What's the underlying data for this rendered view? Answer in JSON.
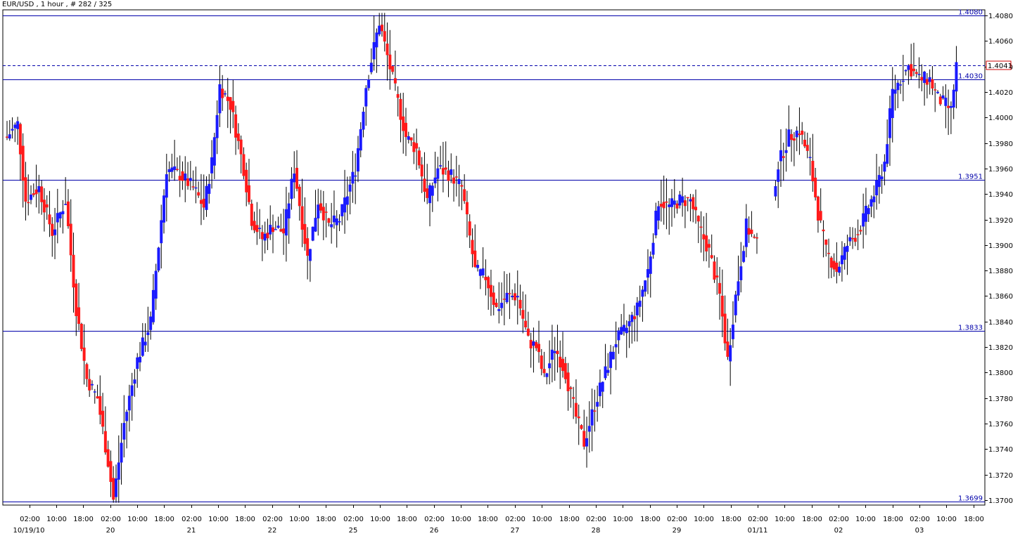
{
  "title": "EUR/USD , 1 hour , # 282 / 325",
  "chart_data": {
    "type": "candlestick",
    "symbol": "EUR/USD",
    "timeframe": "1 hour",
    "ylim": [
      1.3695,
      1.4085
    ],
    "grid": false,
    "colors": {
      "bull": "#1a1aff",
      "bear": "#ff1a1a",
      "wick": "#000000",
      "level": "#0000aa",
      "current": "#0000aa",
      "current_box": "#cc0000"
    },
    "y_ticks": [
      "1.4080",
      "1.4060",
      "1.4040",
      "1.4020",
      "1.4000",
      "1.3980",
      "1.3960",
      "1.3940",
      "1.3920",
      "1.3900",
      "1.3880",
      "1.3860",
      "1.3840",
      "1.3820",
      "1.3800",
      "1.3780",
      "1.3760",
      "1.3740",
      "1.3720",
      "1.3700"
    ],
    "x_ticks": [
      "02:00",
      "10:00",
      "18:00",
      "02:00",
      "10:00",
      "18:00",
      "02:00",
      "10:00",
      "18:00",
      "02:00",
      "10:00",
      "18:00",
      "02:00",
      "10:00",
      "18:00",
      "02:00",
      "10:00",
      "18:00",
      "02:00",
      "10:00",
      "18:00",
      "02:00",
      "10:00",
      "18:00",
      "02:00",
      "10:00",
      "18:00",
      "02:00",
      "10:00",
      "18:00",
      "02:00",
      "10:00",
      "18:00",
      "02:00",
      "10:00",
      "18:00"
    ],
    "day_labels": [
      "10/19/10",
      "20",
      "21",
      "22",
      "25",
      "26",
      "27",
      "28",
      "29",
      "01/11",
      "02",
      "03"
    ],
    "levels": [
      {
        "label": "1.4080",
        "value": 1.408
      },
      {
        "label": "1.4030",
        "value": 1.403
      },
      {
        "label": "1.3951",
        "value": 1.3951
      },
      {
        "label": "1.3833",
        "value": 1.3833
      },
      {
        "label": "1.3699",
        "value": 1.3699
      }
    ],
    "current_price": {
      "label": "1.4041",
      "value": 1.4041
    },
    "key_points": [
      {
        "t": 0,
        "v": 1.3985
      },
      {
        "t": 4,
        "v": 1.3995
      },
      {
        "t": 7,
        "v": 1.3935
      },
      {
        "t": 12,
        "v": 1.3945
      },
      {
        "t": 17,
        "v": 1.391
      },
      {
        "t": 22,
        "v": 1.3935
      },
      {
        "t": 26,
        "v": 1.385
      },
      {
        "t": 30,
        "v": 1.3795
      },
      {
        "t": 34,
        "v": 1.378
      },
      {
        "t": 38,
        "v": 1.373
      },
      {
        "t": 40,
        "v": 1.37
      },
      {
        "t": 44,
        "v": 1.376
      },
      {
        "t": 49,
        "v": 1.381
      },
      {
        "t": 54,
        "v": 1.384
      },
      {
        "t": 57,
        "v": 1.39
      },
      {
        "t": 60,
        "v": 1.396
      },
      {
        "t": 65,
        "v": 1.3955
      },
      {
        "t": 70,
        "v": 1.3945
      },
      {
        "t": 74,
        "v": 1.393
      },
      {
        "t": 77,
        "v": 1.3965
      },
      {
        "t": 80,
        "v": 1.4025
      },
      {
        "t": 84,
        "v": 1.401
      },
      {
        "t": 89,
        "v": 1.396
      },
      {
        "t": 92,
        "v": 1.392
      },
      {
        "t": 96,
        "v": 1.3905
      },
      {
        "t": 100,
        "v": 1.3915
      },
      {
        "t": 104,
        "v": 1.391
      },
      {
        "t": 108,
        "v": 1.396
      },
      {
        "t": 113,
        "v": 1.389
      },
      {
        "t": 117,
        "v": 1.3935
      },
      {
        "t": 121,
        "v": 1.3915
      },
      {
        "t": 125,
        "v": 1.392
      },
      {
        "t": 128,
        "v": 1.394
      },
      {
        "t": 131,
        "v": 1.396
      },
      {
        "t": 135,
        "v": 1.4025
      },
      {
        "t": 140,
        "v": 1.4075
      },
      {
        "t": 145,
        "v": 1.403
      },
      {
        "t": 150,
        "v": 1.3985
      },
      {
        "t": 154,
        "v": 1.3975
      },
      {
        "t": 158,
        "v": 1.3935
      },
      {
        "t": 162,
        "v": 1.396
      },
      {
        "t": 167,
        "v": 1.3955
      },
      {
        "t": 171,
        "v": 1.3945
      },
      {
        "t": 176,
        "v": 1.388
      },
      {
        "t": 180,
        "v": 1.3875
      },
      {
        "t": 184,
        "v": 1.385
      },
      {
        "t": 188,
        "v": 1.386
      },
      {
        "t": 192,
        "v": 1.386
      },
      {
        "t": 196,
        "v": 1.3825
      },
      {
        "t": 199,
        "v": 1.382
      },
      {
        "t": 202,
        "v": 1.3795
      },
      {
        "t": 206,
        "v": 1.382
      },
      {
        "t": 210,
        "v": 1.38
      },
      {
        "t": 214,
        "v": 1.3765
      },
      {
        "t": 217,
        "v": 1.3745
      },
      {
        "t": 221,
        "v": 1.3775
      },
      {
        "t": 225,
        "v": 1.38
      },
      {
        "t": 229,
        "v": 1.3825
      },
      {
        "t": 233,
        "v": 1.3835
      },
      {
        "t": 237,
        "v": 1.385
      },
      {
        "t": 241,
        "v": 1.388
      },
      {
        "t": 245,
        "v": 1.3935
      },
      {
        "t": 249,
        "v": 1.393
      },
      {
        "t": 253,
        "v": 1.3935
      },
      {
        "t": 257,
        "v": 1.3935
      },
      {
        "t": 260,
        "v": 1.3915
      },
      {
        "t": 264,
        "v": 1.3895
      },
      {
        "t": 268,
        "v": 1.386
      },
      {
        "t": 271,
        "v": 1.381
      },
      {
        "t": 274,
        "v": 1.386
      },
      {
        "t": 278,
        "v": 1.3915
      },
      {
        "t": 282,
        "v": 1.39
      },
      {
        "t": 286,
        "v": 1.392
      },
      {
        "t": 288,
        "v": 1.394
      },
      {
        "t": 290,
        "v": 1.3963
      },
      {
        "t": 294,
        "v": 1.3985
      },
      {
        "t": 298,
        "v": 1.399
      },
      {
        "t": 302,
        "v": 1.3965
      },
      {
        "t": 305,
        "v": 1.3925
      },
      {
        "t": 308,
        "v": 1.3895
      },
      {
        "t": 312,
        "v": 1.388
      },
      {
        "t": 316,
        "v": 1.39
      },
      {
        "t": 320,
        "v": 1.391
      },
      {
        "t": 324,
        "v": 1.393
      },
      {
        "t": 327,
        "v": 1.3945
      },
      {
        "t": 330,
        "v": 1.3965
      },
      {
        "t": 333,
        "v": 1.402
      },
      {
        "t": 336,
        "v": 1.403
      },
      {
        "t": 339,
        "v": 1.404
      },
      {
        "t": 343,
        "v": 1.403
      },
      {
        "t": 347,
        "v": 1.403
      },
      {
        "t": 350,
        "v": 1.4015
      },
      {
        "t": 353,
        "v": 1.401
      },
      {
        "t": 355,
        "v": 1.4005
      },
      {
        "t": 357,
        "v": 1.4041
      }
    ]
  }
}
